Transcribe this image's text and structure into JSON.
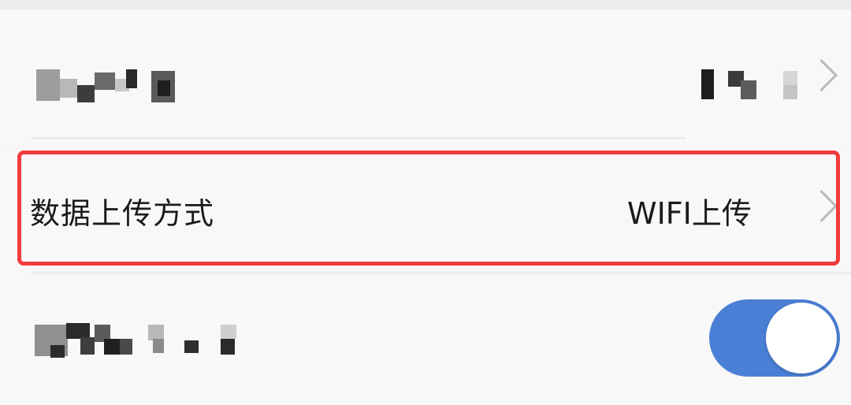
{
  "settings": {
    "data_upload_row": {
      "label": "数据上传方式",
      "value": "WIFI上传"
    },
    "toggle_row": {
      "toggle_on": true
    }
  },
  "icons": {
    "row_chevron": "chevron-right-icon"
  },
  "colors": {
    "highlight": "#f23b3e",
    "toggle_on": "#4a7fd6",
    "chevron": "#b9b9b9"
  }
}
